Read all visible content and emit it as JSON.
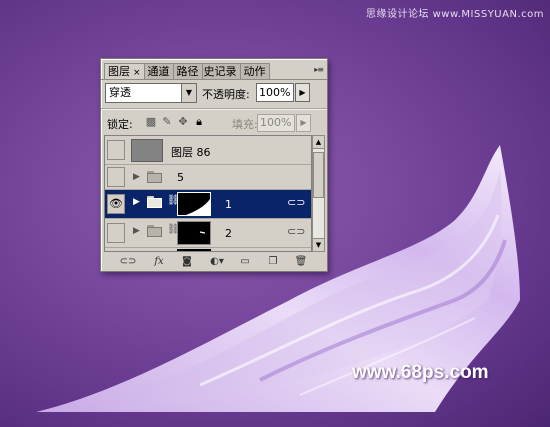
{
  "watermark_top": "思缘设计论坛 www.MISSYUAN.com",
  "watermark_bottom": "www.68ps.com",
  "colors": {
    "background": "#7a4aa0",
    "panel": "#d4d0c8",
    "selection": "#0a246a",
    "fabric": "#e6d6f4"
  },
  "panel": {
    "tabs": [
      {
        "label": "图层",
        "active": true,
        "close": "×"
      },
      {
        "label": "通道",
        "active": false
      },
      {
        "label": "路径",
        "active": false
      },
      {
        "label": "史记录",
        "active": false
      },
      {
        "label": "动作",
        "active": false
      }
    ],
    "menu_icon": "▸≡",
    "blend_mode": "穿透",
    "opacity_label": "不透明度:",
    "opacity_value": "100%",
    "lock_label": "锁定:",
    "fill_label": "填充:",
    "fill_value": "100%",
    "layers": [
      {
        "name": "图层 86",
        "type": "layer",
        "visible": false,
        "selected": false
      },
      {
        "name": "5",
        "type": "group",
        "visible": false,
        "selected": false
      },
      {
        "name": "1",
        "type": "group-mask",
        "visible": true,
        "selected": true
      },
      {
        "name": "2",
        "type": "group-mask",
        "visible": false,
        "selected": false
      }
    ],
    "toolbar": [
      "link-icon",
      "fx-icon",
      "mask-icon",
      "adjustment-icon",
      "folder-icon",
      "new-layer-icon",
      "trash-icon"
    ],
    "toolbar_labels": {
      "fx": "fx"
    }
  }
}
